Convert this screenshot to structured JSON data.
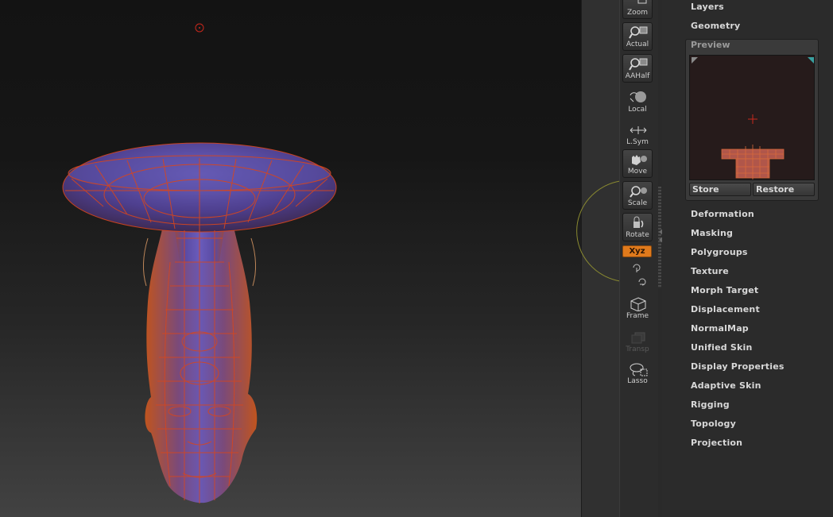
{
  "toolbar": {
    "zoom_label": "Zoom",
    "actual_label": "Actual",
    "aahalf_label": "AAHalf",
    "local_label": "Local",
    "lsym_label": "L.Sym",
    "move_label": "Move",
    "scale_label": "Scale",
    "rotate_label": "Rotate",
    "xyz_label": "Xyz",
    "frame_label": "Frame",
    "transp_label": "Transp",
    "lasso_label": "Lasso"
  },
  "palette": {
    "top_items": [
      "Layers",
      "Geometry"
    ],
    "preview": {
      "title": "Preview",
      "store_label": "Store",
      "restore_label": "Restore"
    },
    "items": [
      "Deformation",
      "Masking",
      "Polygroups",
      "Texture",
      "Morph Target",
      "Displacement",
      "NormalMap",
      "Unified Skin",
      "Display Properties",
      "Adaptive Skin",
      "Rigging",
      "Topology",
      "Projection"
    ]
  },
  "colors": {
    "accent": "#e07a1c",
    "mesh_fill": "#5a4a9a",
    "wire": "#d8461c",
    "viewport_top": "#131313",
    "viewport_bottom": "#424242"
  }
}
